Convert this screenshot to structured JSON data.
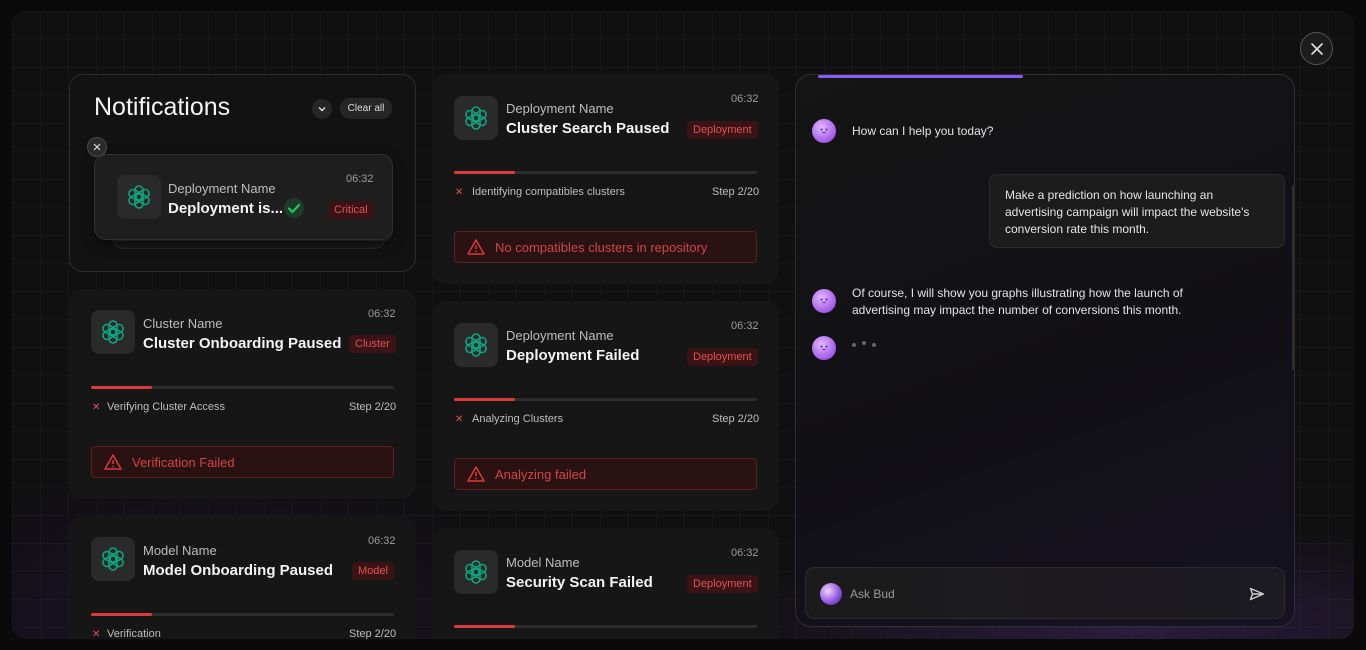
{
  "notifications": {
    "title": "Notifications",
    "clear_all": "Clear all",
    "pinned": {
      "subtitle": "Deployment Name",
      "title": "Deployment is...",
      "time": "06:32",
      "tag": "Critical"
    }
  },
  "cards": [
    {
      "subtitle": "Cluster Name",
      "title": "Cluster Onboarding Paused",
      "time": "06:32",
      "tag": "Cluster",
      "progress": 0.2,
      "step_text": "Verifying Cluster Access",
      "step": "Step 2/20",
      "error": "Verification Failed"
    },
    {
      "subtitle": "Model Name",
      "title": "Model Onboarding Paused",
      "time": "06:32",
      "tag": "Model",
      "progress": 0.2,
      "step_text": "Verification",
      "step": "Step 2/20"
    },
    {
      "subtitle": "Deployment Name",
      "title": "Cluster Search Paused",
      "time": "06:32",
      "tag": "Deployment",
      "progress": 0.2,
      "step_text": "Identifying compatibles clusters",
      "step": "Step 2/20",
      "error": "No compatibles clusters in repository"
    },
    {
      "subtitle": "Deployment Name",
      "title": "Deployment Failed",
      "time": "06:32",
      "tag": "Deployment",
      "progress": 0.2,
      "step_text": "Analyzing Clusters",
      "step": "Step 2/20",
      "error": "Analyzing failed"
    },
    {
      "subtitle": "Model Name",
      "title": "Security Scan Failed",
      "time": "06:32",
      "tag": "Deployment",
      "progress": 0.2
    }
  ],
  "chat": {
    "progress": 0.42,
    "messages": [
      {
        "role": "bot",
        "text": "How can I help you today?"
      },
      {
        "role": "user",
        "text": "Make a prediction on how launching an advertising campaign will impact the website's conversion rate this month."
      },
      {
        "role": "bot",
        "text": "Of course, I will show you graphs illustrating how the launch of advertising may impact the number of conversions this month."
      }
    ],
    "input_placeholder": "Ask Bud"
  },
  "colors": {
    "accent": "#8a5cf5",
    "error": "#d93b3b",
    "success": "#22c55e",
    "logo": "#10a37f"
  },
  "icons": {
    "close": "close-icon",
    "chevron": "chevron-down-icon",
    "logo": "openai-logo-icon",
    "check": "check-circle-icon",
    "warning": "warning-triangle-icon",
    "send": "send-icon"
  }
}
